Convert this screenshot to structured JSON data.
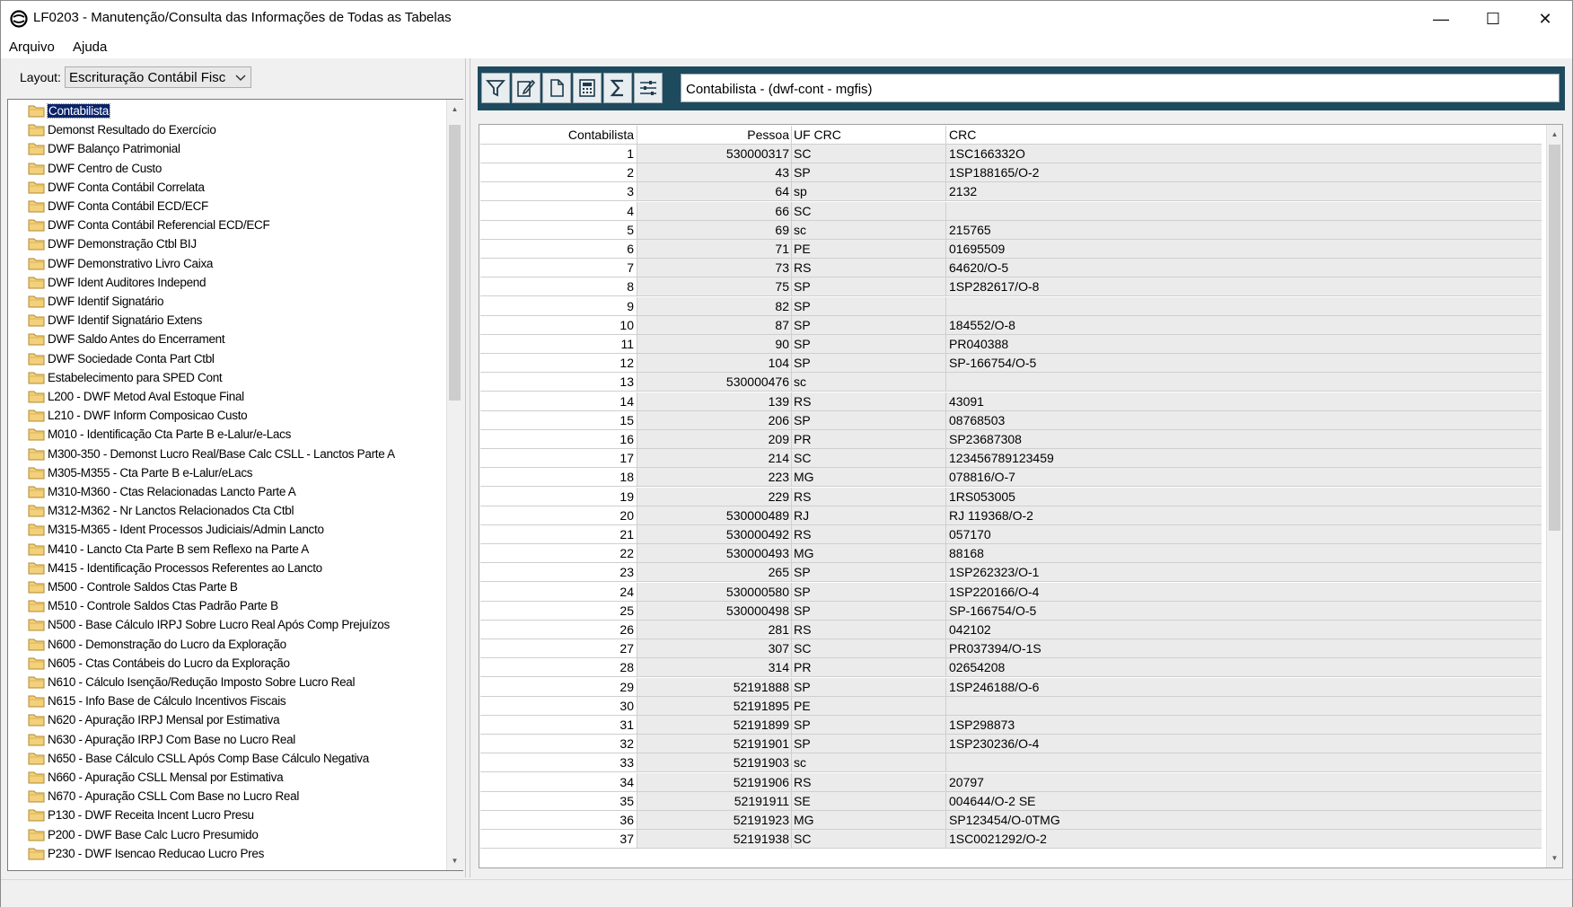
{
  "window": {
    "title": "LF0203 - Manutenção/Consulta das Informações de Todas as Tabelas",
    "minimize": "—",
    "maximize": "☐",
    "close": "✕"
  },
  "menu": {
    "items": [
      "Arquivo",
      "Ajuda"
    ]
  },
  "layout": {
    "label": "Layout:",
    "value": "Escrituração Contábil Fisc"
  },
  "tree": {
    "selected_index": 0,
    "items": [
      "Contabilista",
      "Demonst Resultado do Exercício",
      "DWF Balanço Patrimonial",
      "DWF Centro de Custo",
      "DWF Conta Contábil Correlata",
      "DWF Conta Contábil ECD/ECF",
      "DWF Conta Contábil Referencial ECD/ECF",
      "DWF Demonstração Ctbl BIJ",
      "DWF Demonstrativo Livro Caixa",
      "DWF Ident Auditores Independ",
      "DWF Identif Signatário",
      "DWF Identif Signatário Extens",
      "DWF Saldo Antes do Encerrament",
      "DWF Sociedade Conta Part Ctbl",
      "Estabelecimento para SPED Cont",
      "L200 - DWF Metod Aval Estoque Final",
      "L210 - DWF Inform Composicao Custo",
      "M010 - Identificação Cta Parte B e-Lalur/e-Lacs",
      "M300-350 - Demonst Lucro Real/Base Calc CSLL - Lanctos Parte A",
      "M305-M355 - Cta Parte B e-Lalur/eLacs",
      "M310-M360 - Ctas Relacionadas Lancto Parte A",
      "M312-M362 - Nr Lanctos Relacionados Cta Ctbl",
      "M315-M365 - Ident Processos Judiciais/Admin Lancto",
      "M410 - Lancto Cta Parte B sem Reflexo na Parte A",
      "M415 - Identificação Processos Referentes ao Lancto",
      "M500 - Controle Saldos Ctas Parte B",
      "M510 - Controle Saldos Ctas Padrão Parte B",
      "N500 - Base Cálculo IRPJ Sobre Lucro Real Após Comp Prejuízos",
      "N600 - Demonstração do Lucro da Exploração",
      "N605 - Ctas Contábeis do Lucro da Exploração",
      "N610 - Cálculo Isenção/Redução Imposto Sobre Lucro Real",
      "N615 - Info Base de Cálculo Incentivos Fiscais",
      "N620 - Apuração IRPJ Mensal por Estimativa",
      "N630 - Apuração IRPJ Com Base no Lucro Real",
      "N650 - Base Cálculo CSLL Após Comp Base Cálculo Negativa",
      "N660 - Apuração CSLL Mensal por Estimativa",
      "N670 - Apuração CSLL Com Base no Lucro Real",
      "P130 - DWF Receita Incent Lucro Presu",
      "P200 - DWF Base Calc Lucro Presumido",
      "P230 - DWF Isencao Reducao Lucro Pres"
    ]
  },
  "toolbar": {
    "buttons": [
      "filter-icon",
      "edit-icon",
      "new-document-icon",
      "calculator-icon",
      "sum-icon",
      "settings-sliders-icon"
    ],
    "title": "Contabilista - (dwf-cont - mgfis)"
  },
  "table": {
    "columns": [
      "Contabilista",
      "Pessoa",
      "UF CRC",
      "CRC"
    ],
    "rows": [
      [
        "1",
        "530000317",
        "SC",
        "1SC166332O"
      ],
      [
        "2",
        "43",
        "SP",
        "1SP188165/O-2"
      ],
      [
        "3",
        "64",
        "sp",
        "2132"
      ],
      [
        "4",
        "66",
        "SC",
        ""
      ],
      [
        "5",
        "69",
        "sc",
        "215765"
      ],
      [
        "6",
        "71",
        "PE",
        "01695509"
      ],
      [
        "7",
        "73",
        "RS",
        "64620/O-5"
      ],
      [
        "8",
        "75",
        "SP",
        "1SP282617/O-8"
      ],
      [
        "9",
        "82",
        "SP",
        ""
      ],
      [
        "10",
        "87",
        "SP",
        "184552/O-8"
      ],
      [
        "11",
        "90",
        "SP",
        "PR040388"
      ],
      [
        "12",
        "104",
        "SP",
        "SP-166754/O-5"
      ],
      [
        "13",
        "530000476",
        "sc",
        ""
      ],
      [
        "14",
        "139",
        "RS",
        "43091"
      ],
      [
        "15",
        "206",
        "SP",
        "08768503"
      ],
      [
        "16",
        "209",
        "PR",
        "SP23687308"
      ],
      [
        "17",
        "214",
        "SC",
        "123456789123459"
      ],
      [
        "18",
        "223",
        "MG",
        "078816/O-7"
      ],
      [
        "19",
        "229",
        "RS",
        "1RS053005"
      ],
      [
        "20",
        "530000489",
        "RJ",
        "RJ 119368/O-2"
      ],
      [
        "21",
        "530000492",
        "RS",
        "057170"
      ],
      [
        "22",
        "530000493",
        "MG",
        "88168"
      ],
      [
        "23",
        "265",
        "SP",
        "1SP262323/O-1"
      ],
      [
        "24",
        "530000580",
        "SP",
        "1SP220166/O-4"
      ],
      [
        "25",
        "530000498",
        "SP",
        "SP-166754/O-5"
      ],
      [
        "26",
        "281",
        "RS",
        "042102"
      ],
      [
        "27",
        "307",
        "SC",
        "PR037394/O-1S"
      ],
      [
        "28",
        "314",
        "PR",
        "02654208"
      ],
      [
        "29",
        "52191888",
        "SP",
        "1SP246188/O-6"
      ],
      [
        "30",
        "52191895",
        "PE",
        ""
      ],
      [
        "31",
        "52191899",
        "SP",
        "1SP298873"
      ],
      [
        "32",
        "52191901",
        "SP",
        "1SP230236/O-4"
      ],
      [
        "33",
        "52191903",
        "sc",
        ""
      ],
      [
        "34",
        "52191906",
        "RS",
        "20797"
      ],
      [
        "35",
        "52191911",
        "SE",
        "004644/O-2 SE"
      ],
      [
        "36",
        "52191923",
        "MG",
        "SP123454/O-0TMG"
      ],
      [
        "37",
        "52191938",
        "SC",
        "1SC0021292/O-2"
      ]
    ]
  }
}
